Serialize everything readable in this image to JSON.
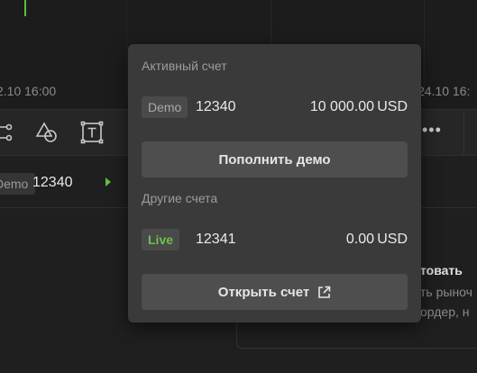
{
  "chart": {
    "axis_labels": [
      "2.10 16:00",
      "24.10 16:"
    ]
  },
  "toolbar": {
    "tools": [
      "connector-tool-icon",
      "shapes-tool-icon",
      "text-tool-icon",
      "more-icon"
    ],
    "more_label": "•••"
  },
  "account_row": {
    "badge": "Demo",
    "number": "12340"
  },
  "side_panel": {
    "title": "товать",
    "line1": "ть рыноч",
    "line2": "ордер, н"
  },
  "popup": {
    "active_title": "Активный счет",
    "active_account": {
      "badge": "Demo",
      "number": "12340",
      "balance": "10 000.00",
      "currency": "USD"
    },
    "topup_button": "Пополнить демо",
    "other_title": "Другие счета",
    "other_account": {
      "badge": "Live",
      "number": "12341",
      "balance": "0.00",
      "currency": "USD"
    },
    "open_button": "Открыть счет"
  },
  "colors": {
    "live_green": "#6cc24a",
    "popup_bg": "#3a3a3a",
    "button_bg": "#4e4e4e"
  }
}
